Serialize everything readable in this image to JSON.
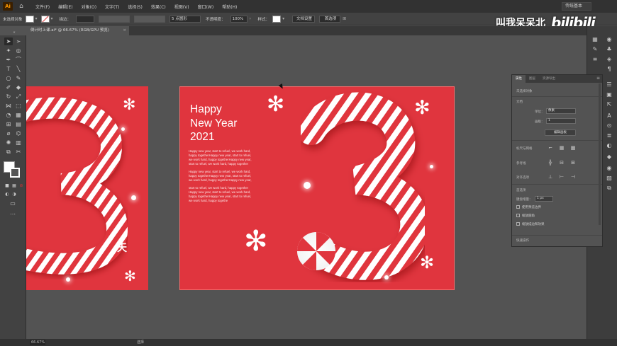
{
  "menubar": {
    "logo": "Ai",
    "items": [
      "文件(F)",
      "编辑(E)",
      "对象(O)",
      "文字(T)",
      "选择(S)",
      "效果(C)",
      "视图(V)",
      "窗口(W)",
      "帮助(H)"
    ],
    "workspace": "传统基本"
  },
  "controlbar": {
    "selection_label": "未选择对象",
    "stroke_label": "描边：",
    "brush_value": "5 点圆形",
    "opacity_label": "不透明度：",
    "opacity_value": "100%",
    "style_label": "样式：",
    "doc_setup_button": "文档设置",
    "preferences_button": "首选项"
  },
  "document_tab": {
    "title": "倒计时上课.ai* @ 66.67% (RGB/GPU 预览)",
    "close": "×"
  },
  "artboard": {
    "title_lines": [
      "Happy",
      "New Year",
      "2021"
    ],
    "body_paragraphs": [
      [
        "Happy new year, start to refuel, we work hard,",
        "happy togetherHappy new year, start to refuel,",
        "we work hard, happy togetherHappy new year,",
        "start to refuel, we work hard, happy together"
      ],
      [
        "Happy new year, start to refuel, we work hard,",
        "happy togetherHappy new year, start to refuel,",
        "we work hard, happy togetherHappy new year,"
      ],
      [
        "start to refuel, we work hard, happy together",
        "Happy new year, start to refuel, we work hard,",
        "happy togetherHappy new year, start to refuel,",
        "we work hard, happy togethe"
      ]
    ],
    "left_label": "天"
  },
  "properties_panel": {
    "tabs": [
      "属性",
      "图层",
      "资源导出"
    ],
    "no_selection": "未选择对象",
    "doc_section": "文档",
    "unit_label": "单位：",
    "unit_value": "像素",
    "artboard_label": "画板：",
    "artboard_value": "1",
    "edit_artboard_button": "编辑画板",
    "ruler_grid_label": "标尺与网格",
    "guides_label": "参考线",
    "snap_label": "对齐选项",
    "prefs_section": "首选项",
    "keyboard_increment_label": "键盘增量：",
    "keyboard_increment_value": "1 px",
    "checkboxes": [
      "使用预览边界",
      "缩放圆角",
      "缩放描边和效果"
    ],
    "quick_actions": "快速操作"
  },
  "statusbar": {
    "zoom": "66.67%",
    "tool": "选择"
  },
  "watermark": {
    "text": "叫我呆呆北",
    "logo": "bilibili"
  },
  "colors": {
    "artboard_red": "#e0353e",
    "ui_dark": "#323232",
    "ui_mid": "#424242",
    "canvas_bg": "#535353"
  }
}
